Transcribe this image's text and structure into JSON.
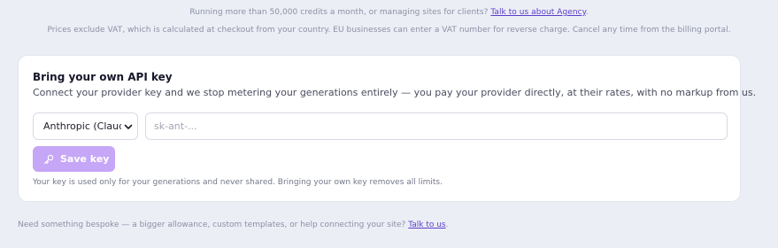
{
  "top_notes": {
    "line1_text": "Running more than 50,000 credits a month, or managing sites for clients?",
    "line1_link": "Talk to us about Agency",
    "line1_end": ".",
    "line2_text": "Prices exclude VAT, which is calculated at checkout from your country. EU businesses can enter a VAT number for reverse charge. Cancel any time from the billing portal."
  },
  "byok": {
    "title": "Bring your own API key",
    "description": "Connect your provider key and we stop metering your generations entirely — you pay your provider directly, at their rates, with no markup from us.",
    "provider_selected": "Anthropic (Claude)",
    "key_input": {
      "value": "",
      "placeholder": "sk-ant-..."
    },
    "save_button": "Save key",
    "note": "Your key is used only for your generations and never shared. Bringing your own key removes all limits."
  },
  "footer": {
    "text": "Need something bespoke — a bigger allowance, custom templates, or help connecting your site?",
    "link": "Talk to us",
    "end": "."
  },
  "colors": {
    "page_bg": "#eceef6",
    "card_bg": "#ffffff",
    "link": "#5b3fc8",
    "button_bg": "#c6a6f6"
  },
  "icons": {
    "select_chevron": "chevron-down-icon",
    "save_icon": "key-icon"
  }
}
